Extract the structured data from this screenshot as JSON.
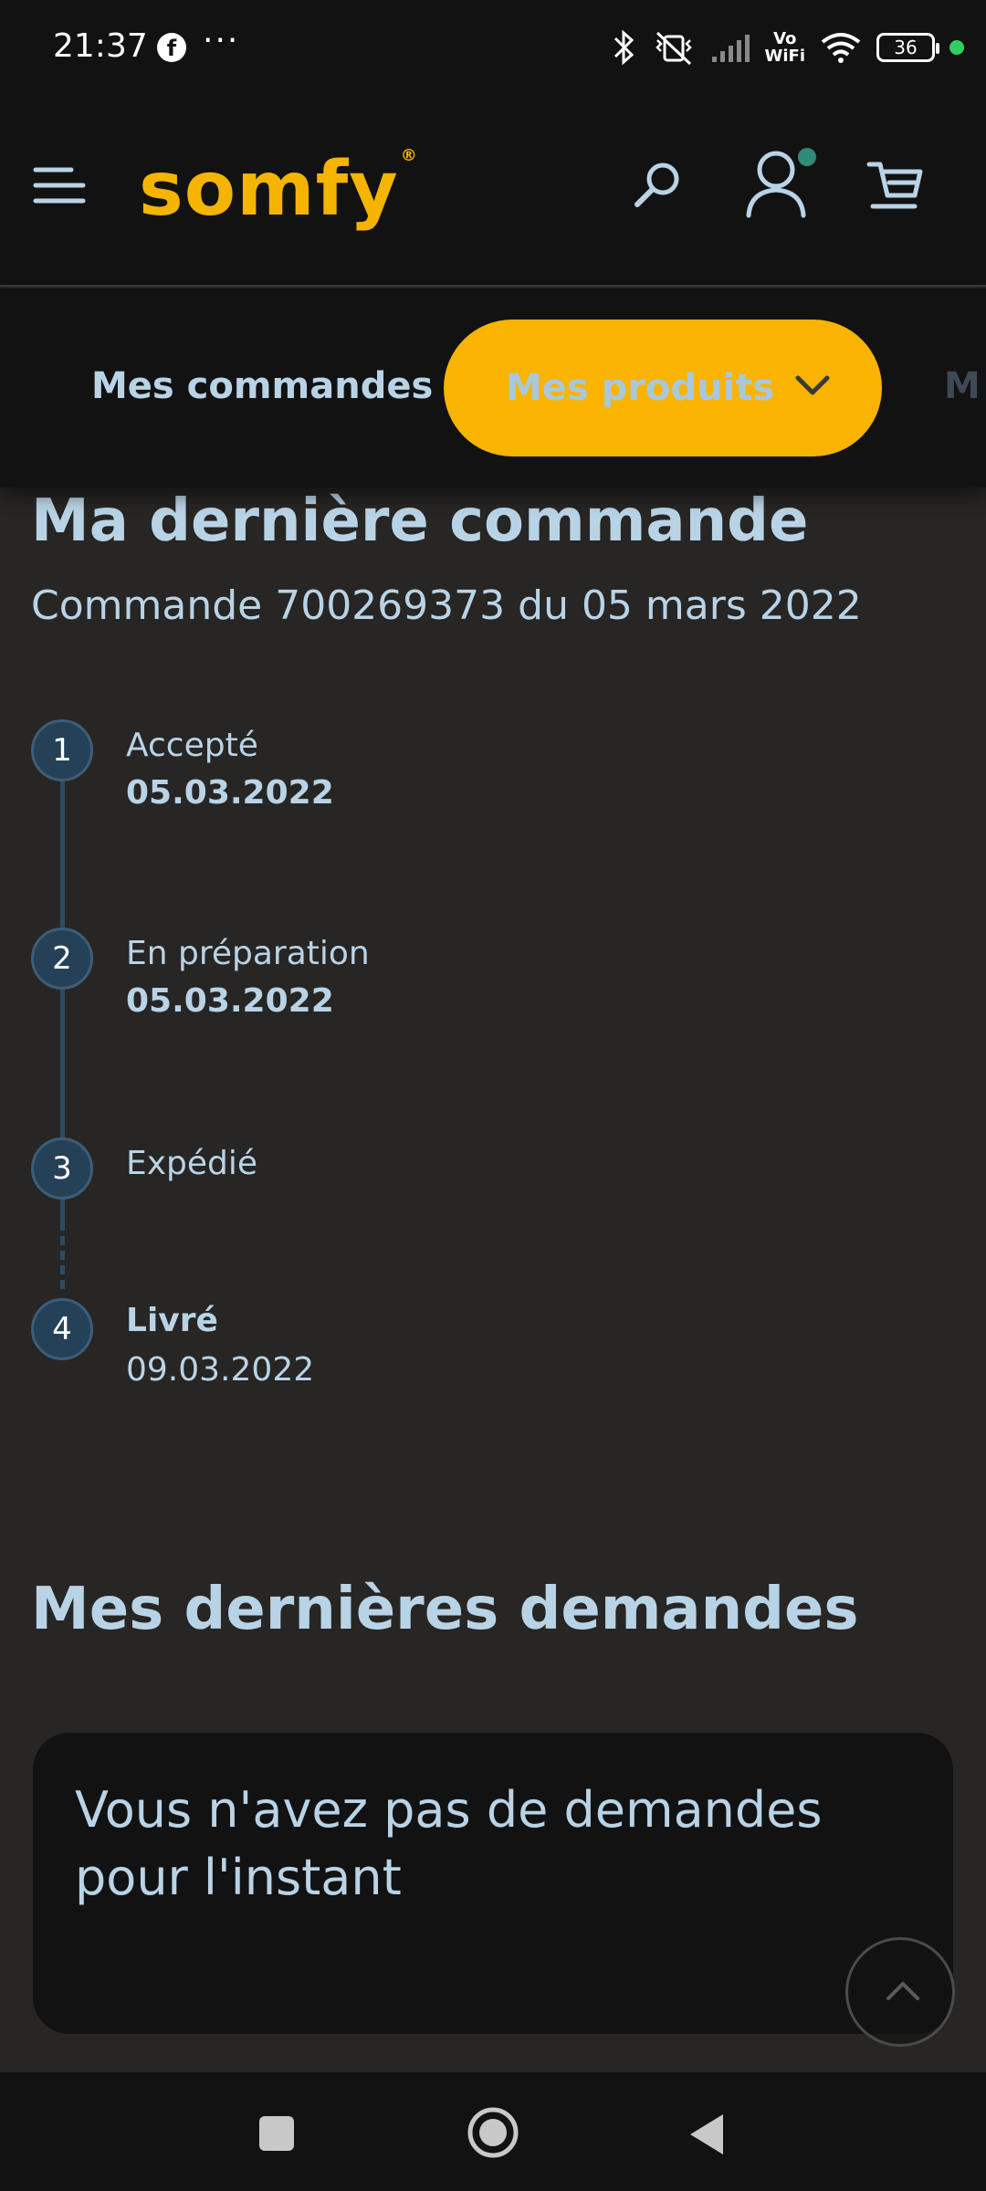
{
  "status_bar": {
    "time": "21:37",
    "battery": "36",
    "icons": [
      "facebook-icon",
      "more-icon",
      "bluetooth-icon",
      "vibrate-off-icon",
      "signal-icon",
      "vowifi-icon",
      "wifi-icon",
      "battery-icon",
      "active-dot-icon"
    ],
    "vowifi_top": "Vo",
    "vowifi_bottom": "WiFi"
  },
  "header": {
    "logo": "somfy",
    "icons": [
      "menu-icon",
      "search-icon",
      "account-icon",
      "cart-icon"
    ],
    "notification_color": "#2e8b7a"
  },
  "tabs": [
    {
      "label": "Mes commandes",
      "active": false
    },
    {
      "label": "Mes produits",
      "active": true
    },
    {
      "label": "M",
      "active": false
    }
  ],
  "order": {
    "title": "Ma dernière commande",
    "subtitle": "Commande 700269373 du 05 mars 2022",
    "steps": [
      {
        "number": "1",
        "label": "Accepté",
        "date": "05.03.2022"
      },
      {
        "number": "2",
        "label": "En préparation",
        "date": "05.03.2022"
      },
      {
        "number": "3",
        "label": "Expédié",
        "date": ""
      },
      {
        "number": "4",
        "label": "Livré",
        "date": "09.03.2022"
      }
    ]
  },
  "requests": {
    "title": "Mes dernières demandes",
    "empty_message": "Vous n'avez pas de demandes pour l'instant"
  },
  "colors": {
    "accent": "#f8b400",
    "background": "#272624",
    "bar": "#121212",
    "text": "#b9d3e6",
    "step_circle": "#254158"
  },
  "nav": {
    "icons": [
      "recents-icon",
      "home-icon",
      "back-icon"
    ]
  }
}
